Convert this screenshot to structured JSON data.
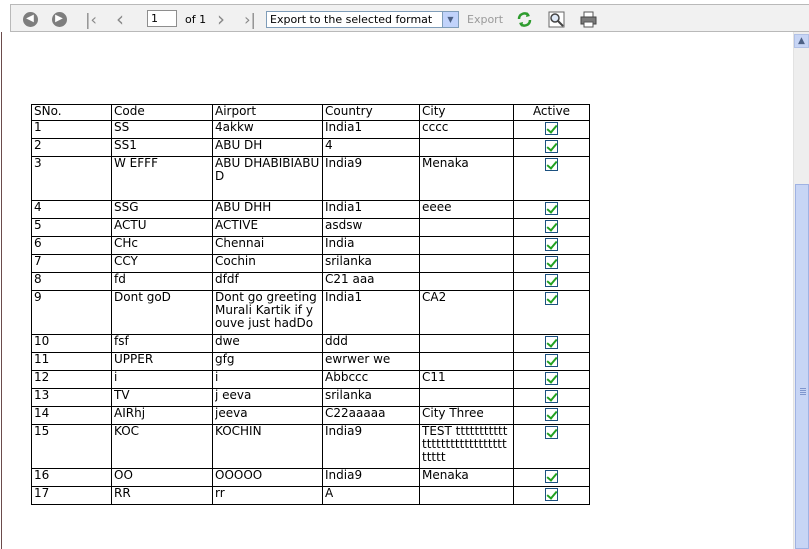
{
  "toolbar": {
    "page_value": "1",
    "of_label": "of 1",
    "format_selected": "Export to the selected format",
    "export_label": "Export",
    "icons": {
      "back": "back-circle-icon",
      "forward": "forward-circle-icon",
      "first": "first-page-icon",
      "prev": "prev-page-icon",
      "next": "next-page-icon",
      "last": "last-page-icon",
      "refresh": "refresh-icon",
      "zoom": "zoom-icon",
      "print": "print-icon"
    }
  },
  "table": {
    "headers": [
      "SNo.",
      "Code",
      "Airport",
      "Country",
      "City",
      "Active"
    ],
    "rows": [
      {
        "sno": "1",
        "code": "SS",
        "airport": "4akkw",
        "country": "India1",
        "city": "cccc",
        "active": true
      },
      {
        "sno": "2",
        "code": "SS1",
        "airport": "ABU DH",
        "country": "4",
        "city": "",
        "active": true
      },
      {
        "sno": "3",
        "code": "W EFFF",
        "airport": "ABU DHABIBIABU D",
        "country": "India9",
        "city": "Menaka",
        "active": true
      },
      {
        "sno": "4",
        "code": "SSG",
        "airport": "ABU DHH",
        "country": "India1",
        "city": "eeee",
        "active": true
      },
      {
        "sno": "5",
        "code": "ACTU",
        "airport": "ACTIVE",
        "country": "asdsw",
        "city": "",
        "active": true
      },
      {
        "sno": "6",
        "code": "CHc",
        "airport": "Chennai",
        "country": "India",
        "city": "",
        "active": true
      },
      {
        "sno": "7",
        "code": "CCY",
        "airport": "Cochin",
        "country": "srilanka",
        "city": "",
        "active": true
      },
      {
        "sno": "8",
        "code": "fd",
        "airport": "dfdf",
        "country": "C21 aaa",
        "city": "",
        "active": true
      },
      {
        "sno": "9",
        "code": "Dont goD",
        "airport": "Dont go greeting Murali Kartik if youve just hadDo",
        "country": "India1",
        "city": "CA2",
        "active": true
      },
      {
        "sno": "10",
        "code": "fsf",
        "airport": "dwe",
        "country": "ddd",
        "city": "",
        "active": true
      },
      {
        "sno": "11",
        "code": "UPPER",
        "airport": "gfg",
        "country": "ewrwer we",
        "city": "",
        "active": true
      },
      {
        "sno": "12",
        "code": "i",
        "airport": "i",
        "country": "Abbccc",
        "city": "C11",
        "active": true
      },
      {
        "sno": "13",
        "code": "TV",
        "airport": "j eeva",
        "country": "srilanka",
        "city": "",
        "active": true
      },
      {
        "sno": "14",
        "code": "AIRhj",
        "airport": "jeeva",
        "country": "C22aaaaa",
        "city": "City Three",
        "active": true
      },
      {
        "sno": "15",
        "code": "KOC",
        "airport": "KOCHIN",
        "country": "India9",
        "city": "TEST tttttttttttttttttttttttttttttttttt",
        "active": true
      },
      {
        "sno": "16",
        "code": "OO",
        "airport": "OOOOO",
        "country": "India9",
        "city": "Menaka",
        "active": true
      },
      {
        "sno": "17",
        "code": "RR",
        "airport": "rr",
        "country": "A",
        "city": "",
        "active": true
      }
    ]
  }
}
